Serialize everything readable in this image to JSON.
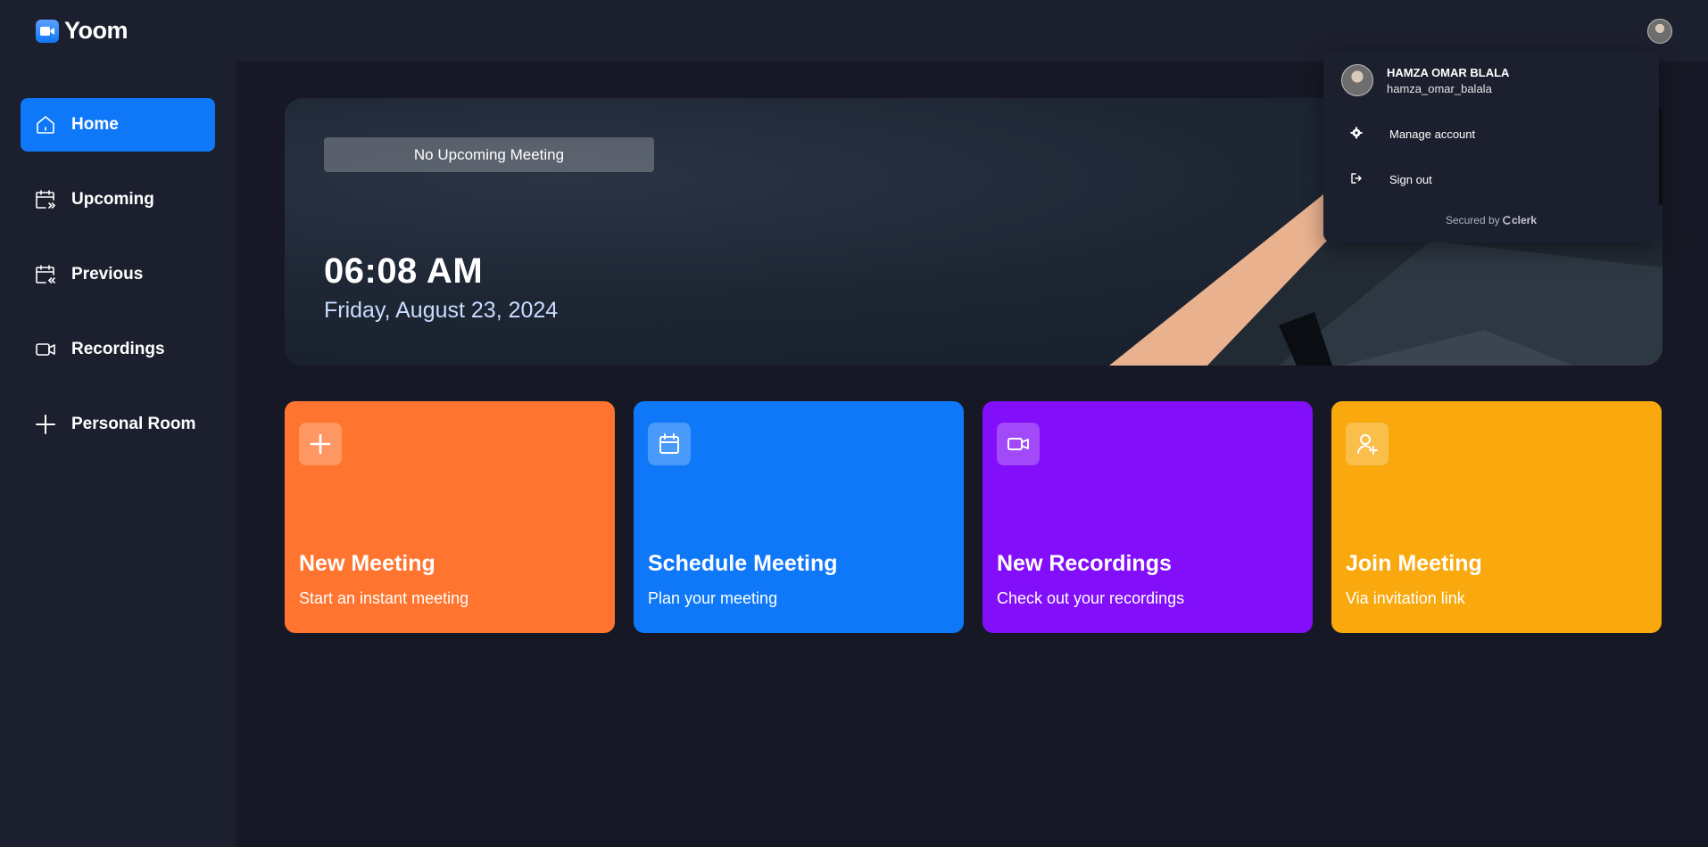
{
  "app": {
    "name": "Yoom"
  },
  "sidebar": {
    "items": [
      {
        "label": "Home",
        "icon": "home-icon",
        "active": true
      },
      {
        "label": "Upcoming",
        "icon": "calendar-forward-icon"
      },
      {
        "label": "Previous",
        "icon": "calendar-back-icon"
      },
      {
        "label": "Recordings",
        "icon": "video-icon"
      },
      {
        "label": "Personal Room",
        "icon": "plus-icon"
      }
    ]
  },
  "hero": {
    "badge": "No Upcoming Meeting",
    "time": "06:08 AM",
    "date": "Friday, August 23, 2024"
  },
  "cards": [
    {
      "title": "New Meeting",
      "subtitle": "Start an instant meeting",
      "icon": "plus-icon",
      "color": "#FF742E"
    },
    {
      "title": "Schedule Meeting",
      "subtitle": "Plan your meeting",
      "icon": "calendar-icon",
      "color": "#0E78F9"
    },
    {
      "title": "New Recordings",
      "subtitle": "Check out your recordings",
      "icon": "video-icon",
      "color": "#830EF9"
    },
    {
      "title": "Join Meeting",
      "subtitle": "Via invitation link",
      "icon": "user-plus-icon",
      "color": "#F9A90E"
    }
  ],
  "user_menu": {
    "name": "HAMZA OMAR BLALA",
    "username": "hamza_omar_balala",
    "manage_label": "Manage account",
    "signout_label": "Sign out",
    "secured_by": "Secured by",
    "provider": "clerk"
  },
  "colors": {
    "background": "#161925",
    "panel": "#1C1F2E",
    "accent": "#0E78F9"
  }
}
